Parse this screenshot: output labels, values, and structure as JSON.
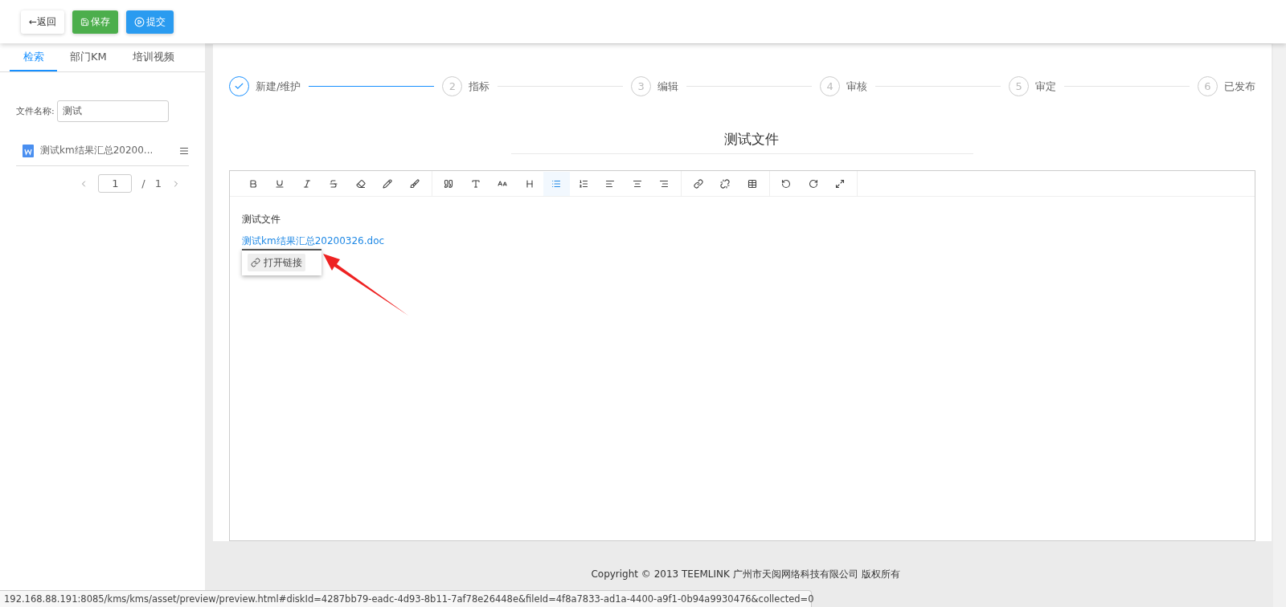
{
  "toolbar": {
    "buttons": [
      {
        "kind": "back",
        "label": "←返回"
      },
      {
        "kind": "save",
        "label": "保存"
      },
      {
        "kind": "submit",
        "label": "提交"
      }
    ]
  },
  "sidebar": {
    "tabs": [
      {
        "label": "检索",
        "selected": true
      },
      {
        "label": "部门KM",
        "selected": false
      },
      {
        "label": "培训视频",
        "selected": false
      }
    ],
    "filter": {
      "label": "文件名称:",
      "value": "测试"
    },
    "files": [
      {
        "name": "测试km结果汇总20200..."
      }
    ],
    "pagination": {
      "page": "1",
      "separator": "/",
      "total": "1"
    }
  },
  "steps": [
    {
      "label": "新建/维护",
      "done": true
    },
    {
      "number": "2",
      "label": "指标",
      "done": false
    },
    {
      "number": "3",
      "label": "编辑",
      "done": false
    },
    {
      "number": "4",
      "label": "审核",
      "done": false
    },
    {
      "number": "5",
      "label": "审定",
      "done": false
    },
    {
      "number": "6",
      "label": "已发布",
      "done": false
    }
  ],
  "document": {
    "title": "测试文件"
  },
  "editor": {
    "tools": [
      {
        "kind": "bold"
      },
      {
        "kind": "underline"
      },
      {
        "kind": "italic"
      },
      {
        "kind": "strike"
      },
      {
        "kind": "eraser"
      },
      {
        "kind": "pencil"
      },
      {
        "kind": "brush"
      },
      {
        "kind": "sep"
      },
      {
        "kind": "quote"
      },
      {
        "kind": "font"
      },
      {
        "kind": "size"
      },
      {
        "kind": "heading"
      },
      {
        "kind": "ul",
        "selected": true
      },
      {
        "kind": "ol",
        "selected": false
      },
      {
        "kind": "left",
        "selected": false
      },
      {
        "kind": "center",
        "selected": false
      },
      {
        "kind": "right",
        "selected": false
      },
      {
        "kind": "sep"
      },
      {
        "kind": "link"
      },
      {
        "kind": "unlink"
      },
      {
        "kind": "table"
      },
      {
        "kind": "sep"
      },
      {
        "kind": "undo"
      },
      {
        "kind": "redo"
      },
      {
        "kind": "fullscreen"
      },
      {
        "kind": "sep"
      }
    ],
    "paragraph": "测试文件",
    "link": "测试km结果汇总20200326.doc",
    "popup": {
      "label": "打开链接"
    }
  },
  "footer": {
    "copyright": "Copyright © 2013 TEEMLINK 广州市天阅网络科技有限公司 版权所有"
  },
  "status_url": "192.168.88.191:8085/kms/kms/asset/preview/preview.html#diskId=4287bb79-eadc-4d93-8b11-7af78e26448e&fileId=4f8a7833-ad1a-4400-a9f1-0b94a9930476&collected=0"
}
